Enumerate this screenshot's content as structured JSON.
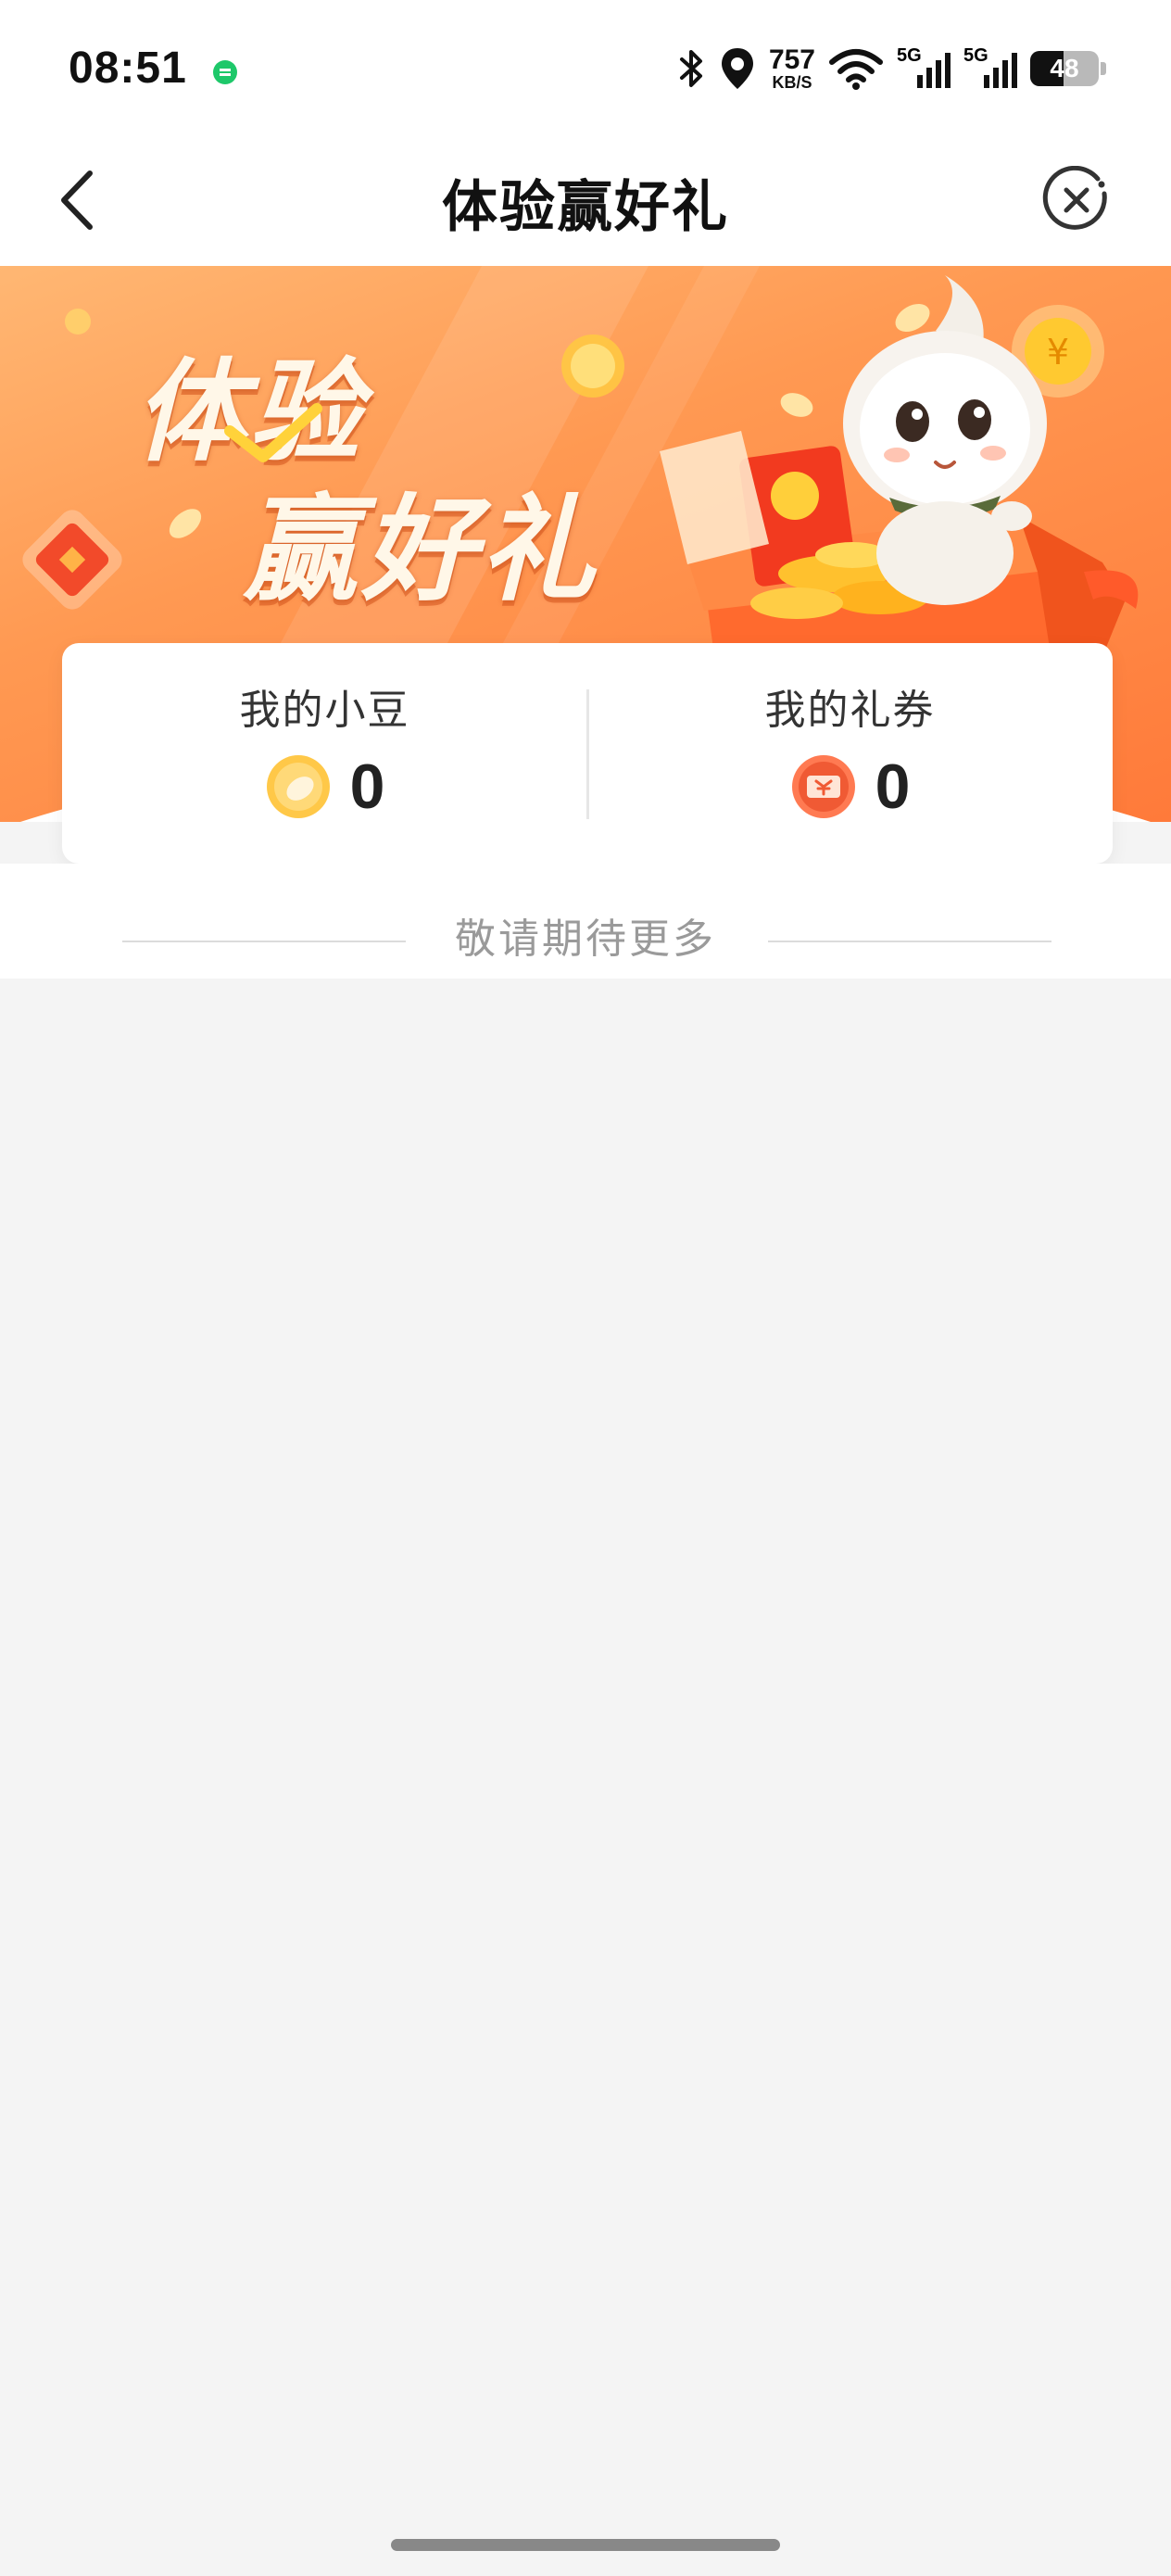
{
  "status_bar": {
    "time": "08:51",
    "net_speed_value": "757",
    "net_speed_unit": "KB/S",
    "signal_1": "5G",
    "signal_2": "5G",
    "battery_level": "48"
  },
  "nav": {
    "title": "体验赢好礼"
  },
  "banner": {
    "headline_1": "体验",
    "headline_2": "赢好礼"
  },
  "stats": {
    "beans": {
      "label": "我的小豆",
      "value": "0",
      "icon": "bean-coin-icon"
    },
    "coupons": {
      "label": "我的礼券",
      "value": "0",
      "icon": "coupon-icon"
    }
  },
  "more": {
    "text": "敬请期待更多"
  },
  "colors": {
    "accent_orange": "#ff8a45",
    "status_dot_green": "#1ec86a",
    "background": "#f4f4f4"
  }
}
